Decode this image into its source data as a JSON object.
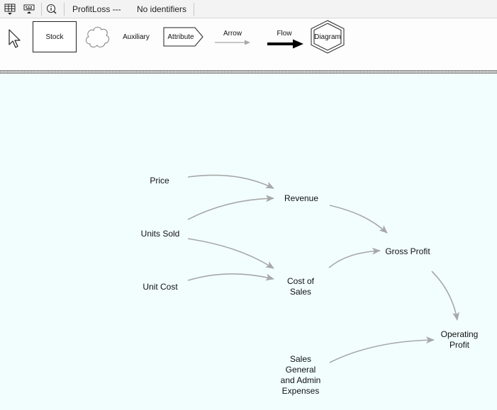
{
  "toolbar": {
    "table_icon": "table-dropdown-icon",
    "keyboard_icon": "keyboard-icon",
    "info_icon": "info-icon",
    "model_name": "ProfitLoss ---",
    "identifier_status": "No identifiers"
  },
  "palette": {
    "pointer_icon": "pointer-arrow-icon",
    "stock_label": "Stock",
    "cloud_icon": "cloud-icon",
    "auxiliary_label": "Auxiliary",
    "attribute_label": "Attribute",
    "arrow_label": "Arrow",
    "flow_label": "Flow",
    "diagram_label": "Diagram"
  },
  "diagram": {
    "variables": {
      "price": "Price",
      "units_sold": "Units Sold",
      "unit_cost": "Unit Cost",
      "revenue": "Revenue",
      "cost_of_sales": "Cost of\nSales",
      "gross_profit": "Gross Profit",
      "operating_profit": "Operating\nProfit",
      "sga": "Sales\nGeneral\nand Admin\nExpenses"
    },
    "links": [
      {
        "from": "Price",
        "to": "Revenue"
      },
      {
        "from": "Units Sold",
        "to": "Revenue"
      },
      {
        "from": "Units Sold",
        "to": "Cost of Sales"
      },
      {
        "from": "Unit Cost",
        "to": "Cost of Sales"
      },
      {
        "from": "Revenue",
        "to": "Gross Profit"
      },
      {
        "from": "Cost of Sales",
        "to": "Gross Profit"
      },
      {
        "from": "Gross Profit",
        "to": "Operating Profit"
      },
      {
        "from": "Sales General and Admin Expenses",
        "to": "Operating Profit"
      }
    ],
    "colors": {
      "canvas_background": "#f2fefe",
      "link_color": "#a8a8a8"
    }
  }
}
